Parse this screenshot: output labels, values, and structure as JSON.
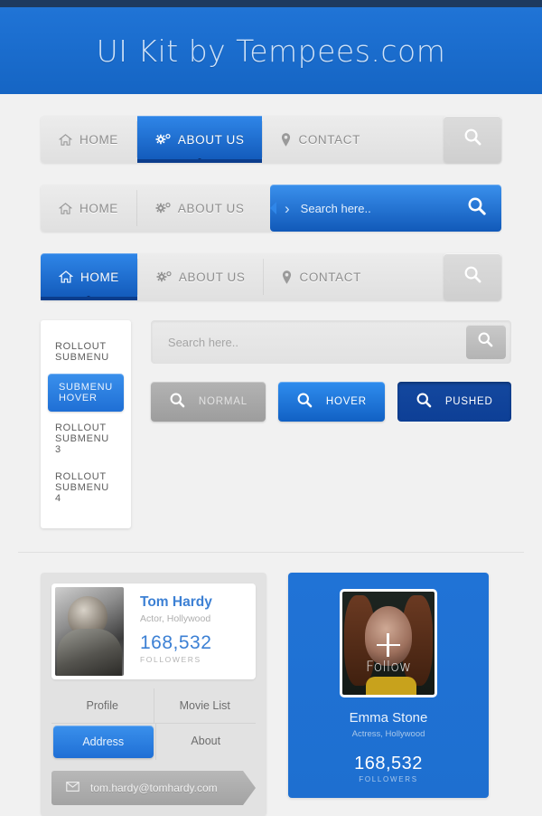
{
  "header": {
    "title": "UI Kit by Tempees.com",
    "accent": "#1d6fd0",
    "bg_dark": "#1e3a5f"
  },
  "navbar1": {
    "items": [
      {
        "label": "HOME",
        "icon": "home-icon",
        "active": false
      },
      {
        "label": "ABOUT US",
        "icon": "gear-icon",
        "active": true
      },
      {
        "label": "CONTACT",
        "icon": "map-pin-icon",
        "active": false
      }
    ],
    "search_icon": "search-icon"
  },
  "navbar2": {
    "items": [
      {
        "label": "HOME",
        "icon": "home-icon",
        "active": false
      },
      {
        "label": "ABOUT US",
        "icon": "gear-icon",
        "active": false
      }
    ],
    "search_field": {
      "placeholder": "Search here..",
      "value": "",
      "chevron": "›",
      "icon": "search-icon"
    }
  },
  "navbar3": {
    "items": [
      {
        "label": "HOME",
        "icon": "home-icon",
        "active": true
      },
      {
        "label": "ABOUT US",
        "icon": "gear-icon",
        "active": false
      },
      {
        "label": "CONTACT",
        "icon": "map-pin-icon",
        "active": false
      }
    ],
    "search_icon": "search-icon"
  },
  "submenu": {
    "items": [
      {
        "label": "ROLLOUT SUBMENU",
        "state": "normal"
      },
      {
        "label": "SUBMENU HOVER",
        "state": "hover"
      },
      {
        "label": "ROLLOUT SUBMENU 3",
        "state": "normal"
      },
      {
        "label": "ROLLOUT SUBMENU 4",
        "state": "normal"
      }
    ]
  },
  "searchbox": {
    "placeholder": "Search here..",
    "value": "",
    "icon": "search-icon"
  },
  "buttons": [
    {
      "label": "NORMAL",
      "state": "normal",
      "icon": "search-icon",
      "color": "#a8a8a8"
    },
    {
      "label": "HOVER",
      "state": "hover",
      "icon": "search-icon",
      "color": "#1f74d8"
    },
    {
      "label": "PUSHED",
      "state": "pushed",
      "icon": "search-icon",
      "color": "#0f4499"
    }
  ],
  "card_tom": {
    "name": "Tom Hardy",
    "role": "Actor, Hollywood",
    "followers_count": "168,532",
    "followers_label": "FOLLOWERS",
    "name_color": "#3c80d4",
    "tabs": [
      {
        "label": "Profile",
        "active": false
      },
      {
        "label": "Movie List",
        "active": false
      },
      {
        "label": "Address",
        "active": true
      },
      {
        "label": "About",
        "active": false
      }
    ],
    "email": {
      "address": "tom.hardy@tomhardy.com",
      "icon": "envelope-icon"
    },
    "photo_alt": "tom-hardy-portrait"
  },
  "card_emma": {
    "name": "Emma Stone",
    "role": "Actress, Hollywood",
    "followers_count": "168,532",
    "followers_label": "FOLLOWERS",
    "follow_label": "Follow",
    "follow_icon": "plus-icon",
    "bg_color": "#1e6fd0",
    "photo_alt": "emma-stone-portrait"
  }
}
